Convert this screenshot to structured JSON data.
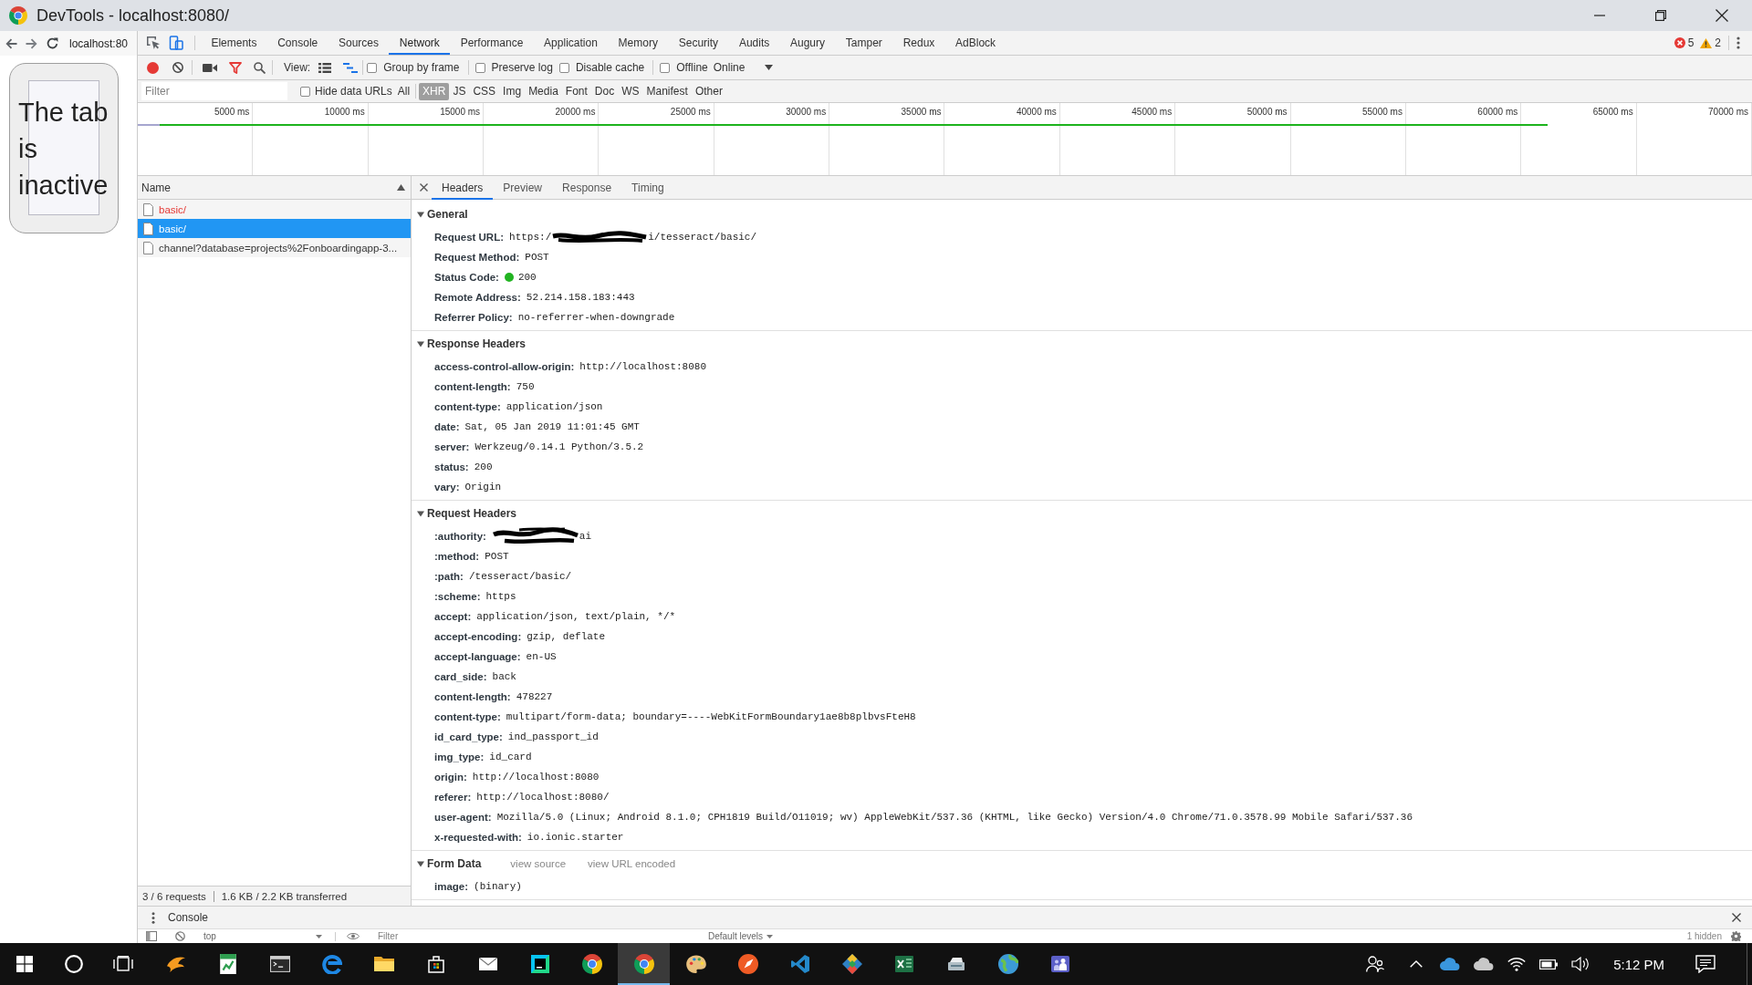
{
  "window": {
    "title": "DevTools - localhost:8080/"
  },
  "browser_pane": {
    "address": "localhost:80",
    "message": "The tab is inactive"
  },
  "devtools": {
    "tabs": [
      {
        "label": "Elements",
        "selected": false
      },
      {
        "label": "Console",
        "selected": false
      },
      {
        "label": "Sources",
        "selected": false
      },
      {
        "label": "Network",
        "selected": true
      },
      {
        "label": "Performance",
        "selected": false
      },
      {
        "label": "Application",
        "selected": false
      },
      {
        "label": "Memory",
        "selected": false
      },
      {
        "label": "Security",
        "selected": false
      },
      {
        "label": "Audits",
        "selected": false
      },
      {
        "label": "Augury",
        "selected": false
      },
      {
        "label": "Tamper",
        "selected": false
      },
      {
        "label": "Redux",
        "selected": false
      },
      {
        "label": "AdBlock",
        "selected": false
      }
    ],
    "error_count": "5",
    "warning_count": "2"
  },
  "network_toolbar": {
    "recording": true,
    "filter_active": true,
    "view_label": "View:",
    "large_rows": false,
    "show_overview": true,
    "options": [
      {
        "label": "Group by frame",
        "checked": false
      },
      {
        "label": "Preserve log",
        "checked": false
      },
      {
        "label": "Disable cache",
        "checked": false
      },
      {
        "label": "Offline",
        "checked": false
      }
    ],
    "throttling": "Online"
  },
  "filter_bar": {
    "placeholder": "Filter",
    "hide_data_urls": {
      "label": "Hide data URLs",
      "checked": false
    },
    "types": [
      {
        "label": "All",
        "selected": false
      },
      {
        "label": "XHR",
        "selected": true
      },
      {
        "label": "JS",
        "selected": false
      },
      {
        "label": "CSS",
        "selected": false
      },
      {
        "label": "Img",
        "selected": false
      },
      {
        "label": "Media",
        "selected": false
      },
      {
        "label": "Font",
        "selected": false
      },
      {
        "label": "Doc",
        "selected": false
      },
      {
        "label": "WS",
        "selected": false
      },
      {
        "label": "Manifest",
        "selected": false
      },
      {
        "label": "Other",
        "selected": false
      }
    ]
  },
  "overview": {
    "ticks": [
      "5000 ms",
      "10000 ms",
      "15000 ms",
      "20000 ms",
      "25000 ms",
      "30000 ms",
      "35000 ms",
      "40000 ms",
      "45000 ms",
      "50000 ms",
      "55000 ms",
      "60000 ms",
      "65000 ms",
      "70000 ms"
    ]
  },
  "requests": {
    "column": "Name",
    "rows": [
      {
        "name": "basic/",
        "failed": true,
        "selected": false
      },
      {
        "name": "basic/",
        "failed": false,
        "selected": true
      },
      {
        "name": "channel?database=projects%2Fonboardingapp-3...",
        "failed": false,
        "selected": false
      }
    ],
    "summary": [
      "3 / 6 requests",
      "1.6 KB / 2.2 KB transferred"
    ]
  },
  "details": {
    "tabs": [
      {
        "label": "Headers",
        "selected": true
      },
      {
        "label": "Preview",
        "selected": false
      },
      {
        "label": "Response",
        "selected": false
      },
      {
        "label": "Timing",
        "selected": false
      }
    ],
    "sections": [
      {
        "title": "General",
        "expanded": true,
        "rows": [
          {
            "kind": "redacted",
            "name": "Request URL:",
            "value": "https:/",
            "value_after": "i/tesseract/basic/"
          },
          {
            "kind": "text",
            "name": "Request Method:",
            "value": "POST"
          },
          {
            "kind": "status",
            "name": "Status Code:",
            "value": "200",
            "color": "#22b422"
          },
          {
            "kind": "text",
            "name": "Remote Address:",
            "value": "52.214.158.183:443"
          },
          {
            "kind": "text",
            "name": "Referrer Policy:",
            "value": "no-referrer-when-downgrade"
          }
        ]
      },
      {
        "title": "Response Headers",
        "expanded": true,
        "rows": [
          {
            "kind": "text",
            "name": "access-control-allow-origin:",
            "value": "http://localhost:8080"
          },
          {
            "kind": "text",
            "name": "content-length:",
            "value": "750"
          },
          {
            "kind": "text",
            "name": "content-type:",
            "value": "application/json"
          },
          {
            "kind": "text",
            "name": "date:",
            "value": "Sat, 05 Jan 2019 11:01:45 GMT"
          },
          {
            "kind": "text",
            "name": "server:",
            "value": "Werkzeug/0.14.1 Python/3.5.2"
          },
          {
            "kind": "text",
            "name": "status:",
            "value": "200"
          },
          {
            "kind": "text",
            "name": "vary:",
            "value": "Origin"
          }
        ]
      },
      {
        "title": "Request Headers",
        "expanded": true,
        "rows": [
          {
            "kind": "redacted",
            "name": ":authority:",
            "value_after": "ai"
          },
          {
            "kind": "text",
            "name": ":method:",
            "value": "POST"
          },
          {
            "kind": "text",
            "name": ":path:",
            "value": "/tesseract/basic/"
          },
          {
            "kind": "text",
            "name": ":scheme:",
            "value": "https"
          },
          {
            "kind": "text",
            "name": "accept:",
            "value": "application/json, text/plain, */*"
          },
          {
            "kind": "text",
            "name": "accept-encoding:",
            "value": "gzip, deflate"
          },
          {
            "kind": "text",
            "name": "accept-language:",
            "value": "en-US"
          },
          {
            "kind": "text",
            "name": "card_side:",
            "value": "back"
          },
          {
            "kind": "text",
            "name": "content-length:",
            "value": "478227"
          },
          {
            "kind": "text",
            "name": "content-type:",
            "value": "multipart/form-data; boundary=----WebKitFormBoundary1ae8b8plbvsFteH8"
          },
          {
            "kind": "text",
            "name": "id_card_type:",
            "value": "ind_passport_id"
          },
          {
            "kind": "text",
            "name": "img_type:",
            "value": "id_card"
          },
          {
            "kind": "text",
            "name": "origin:",
            "value": "http://localhost:8080"
          },
          {
            "kind": "text",
            "name": "referer:",
            "value": "http://localhost:8080/"
          },
          {
            "kind": "text",
            "name": "user-agent:",
            "value": "Mozilla/5.0 (Linux; Android 8.1.0; CPH1819 Build/O11019; wv) AppleWebKit/537.36 (KHTML, like Gecko) Version/4.0 Chrome/71.0.3578.99 Mobile Safari/537.36"
          },
          {
            "kind": "text",
            "name": "x-requested-with:",
            "value": "io.ionic.starter"
          }
        ]
      },
      {
        "title": "Form Data",
        "expanded": true,
        "links": [
          "view source",
          "view URL encoded"
        ],
        "rows": [
          {
            "kind": "text",
            "name": "image:",
            "value": "(binary)"
          }
        ]
      }
    ]
  },
  "console_drawer": {
    "tab": "Console",
    "context": "top",
    "filter_placeholder": "Filter",
    "levels": "Default levels",
    "hidden": "1 hidden"
  },
  "taskbar": {
    "apps": [
      {
        "kind": "wing",
        "active": false
      },
      {
        "kind": "chart_sheet",
        "active": false
      },
      {
        "kind": "terminal",
        "active": false
      },
      {
        "kind": "e_logo",
        "active": false
      },
      {
        "kind": "folder",
        "active": false
      },
      {
        "kind": "bag",
        "active": false
      },
      {
        "kind": "envelope",
        "active": false
      },
      {
        "kind": "ide_tile",
        "active": false
      },
      {
        "kind": "wheel",
        "active": false
      },
      {
        "kind": "wheel",
        "active": true
      },
      {
        "kind": "palette",
        "active": false
      },
      {
        "kind": "compass",
        "active": false
      },
      {
        "kind": "ribbon",
        "active": false
      },
      {
        "kind": "diamond",
        "active": false
      },
      {
        "kind": "spreadsheet",
        "active": false
      },
      {
        "kind": "scanner",
        "active": false
      },
      {
        "kind": "globe",
        "active": false
      },
      {
        "kind": "people_tile",
        "active": false
      }
    ],
    "clock": "5:12 PM"
  }
}
